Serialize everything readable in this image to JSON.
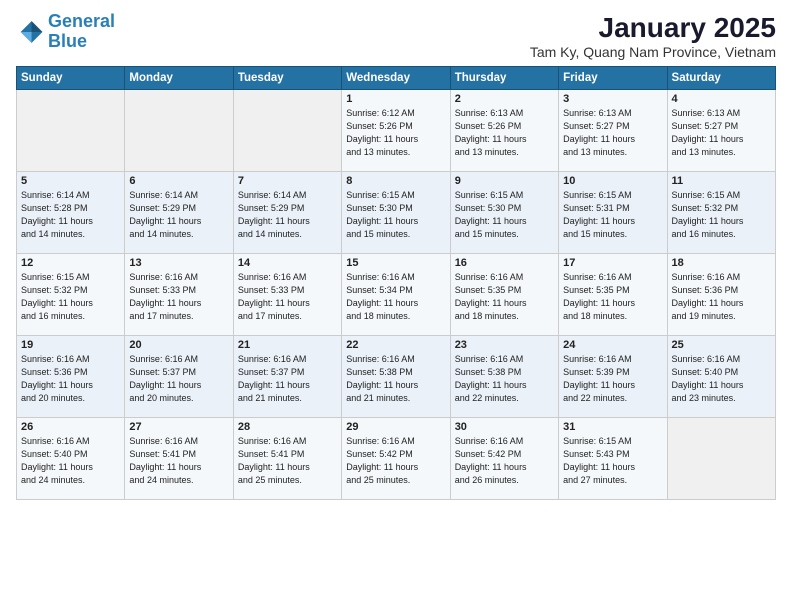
{
  "logo": {
    "line1": "General",
    "line2": "Blue"
  },
  "title": "January 2025",
  "subtitle": "Tam Ky, Quang Nam Province, Vietnam",
  "days_of_week": [
    "Sunday",
    "Monday",
    "Tuesday",
    "Wednesday",
    "Thursday",
    "Friday",
    "Saturday"
  ],
  "weeks": [
    [
      {
        "day": "",
        "info": ""
      },
      {
        "day": "",
        "info": ""
      },
      {
        "day": "",
        "info": ""
      },
      {
        "day": "1",
        "info": "Sunrise: 6:12 AM\nSunset: 5:26 PM\nDaylight: 11 hours\nand 13 minutes."
      },
      {
        "day": "2",
        "info": "Sunrise: 6:13 AM\nSunset: 5:26 PM\nDaylight: 11 hours\nand 13 minutes."
      },
      {
        "day": "3",
        "info": "Sunrise: 6:13 AM\nSunset: 5:27 PM\nDaylight: 11 hours\nand 13 minutes."
      },
      {
        "day": "4",
        "info": "Sunrise: 6:13 AM\nSunset: 5:27 PM\nDaylight: 11 hours\nand 13 minutes."
      }
    ],
    [
      {
        "day": "5",
        "info": "Sunrise: 6:14 AM\nSunset: 5:28 PM\nDaylight: 11 hours\nand 14 minutes."
      },
      {
        "day": "6",
        "info": "Sunrise: 6:14 AM\nSunset: 5:29 PM\nDaylight: 11 hours\nand 14 minutes."
      },
      {
        "day": "7",
        "info": "Sunrise: 6:14 AM\nSunset: 5:29 PM\nDaylight: 11 hours\nand 14 minutes."
      },
      {
        "day": "8",
        "info": "Sunrise: 6:15 AM\nSunset: 5:30 PM\nDaylight: 11 hours\nand 15 minutes."
      },
      {
        "day": "9",
        "info": "Sunrise: 6:15 AM\nSunset: 5:30 PM\nDaylight: 11 hours\nand 15 minutes."
      },
      {
        "day": "10",
        "info": "Sunrise: 6:15 AM\nSunset: 5:31 PM\nDaylight: 11 hours\nand 15 minutes."
      },
      {
        "day": "11",
        "info": "Sunrise: 6:15 AM\nSunset: 5:32 PM\nDaylight: 11 hours\nand 16 minutes."
      }
    ],
    [
      {
        "day": "12",
        "info": "Sunrise: 6:15 AM\nSunset: 5:32 PM\nDaylight: 11 hours\nand 16 minutes."
      },
      {
        "day": "13",
        "info": "Sunrise: 6:16 AM\nSunset: 5:33 PM\nDaylight: 11 hours\nand 17 minutes."
      },
      {
        "day": "14",
        "info": "Sunrise: 6:16 AM\nSunset: 5:33 PM\nDaylight: 11 hours\nand 17 minutes."
      },
      {
        "day": "15",
        "info": "Sunrise: 6:16 AM\nSunset: 5:34 PM\nDaylight: 11 hours\nand 18 minutes."
      },
      {
        "day": "16",
        "info": "Sunrise: 6:16 AM\nSunset: 5:35 PM\nDaylight: 11 hours\nand 18 minutes."
      },
      {
        "day": "17",
        "info": "Sunrise: 6:16 AM\nSunset: 5:35 PM\nDaylight: 11 hours\nand 18 minutes."
      },
      {
        "day": "18",
        "info": "Sunrise: 6:16 AM\nSunset: 5:36 PM\nDaylight: 11 hours\nand 19 minutes."
      }
    ],
    [
      {
        "day": "19",
        "info": "Sunrise: 6:16 AM\nSunset: 5:36 PM\nDaylight: 11 hours\nand 20 minutes."
      },
      {
        "day": "20",
        "info": "Sunrise: 6:16 AM\nSunset: 5:37 PM\nDaylight: 11 hours\nand 20 minutes."
      },
      {
        "day": "21",
        "info": "Sunrise: 6:16 AM\nSunset: 5:37 PM\nDaylight: 11 hours\nand 21 minutes."
      },
      {
        "day": "22",
        "info": "Sunrise: 6:16 AM\nSunset: 5:38 PM\nDaylight: 11 hours\nand 21 minutes."
      },
      {
        "day": "23",
        "info": "Sunrise: 6:16 AM\nSunset: 5:38 PM\nDaylight: 11 hours\nand 22 minutes."
      },
      {
        "day": "24",
        "info": "Sunrise: 6:16 AM\nSunset: 5:39 PM\nDaylight: 11 hours\nand 22 minutes."
      },
      {
        "day": "25",
        "info": "Sunrise: 6:16 AM\nSunset: 5:40 PM\nDaylight: 11 hours\nand 23 minutes."
      }
    ],
    [
      {
        "day": "26",
        "info": "Sunrise: 6:16 AM\nSunset: 5:40 PM\nDaylight: 11 hours\nand 24 minutes."
      },
      {
        "day": "27",
        "info": "Sunrise: 6:16 AM\nSunset: 5:41 PM\nDaylight: 11 hours\nand 24 minutes."
      },
      {
        "day": "28",
        "info": "Sunrise: 6:16 AM\nSunset: 5:41 PM\nDaylight: 11 hours\nand 25 minutes."
      },
      {
        "day": "29",
        "info": "Sunrise: 6:16 AM\nSunset: 5:42 PM\nDaylight: 11 hours\nand 25 minutes."
      },
      {
        "day": "30",
        "info": "Sunrise: 6:16 AM\nSunset: 5:42 PM\nDaylight: 11 hours\nand 26 minutes."
      },
      {
        "day": "31",
        "info": "Sunrise: 6:15 AM\nSunset: 5:43 PM\nDaylight: 11 hours\nand 27 minutes."
      },
      {
        "day": "",
        "info": ""
      }
    ]
  ]
}
